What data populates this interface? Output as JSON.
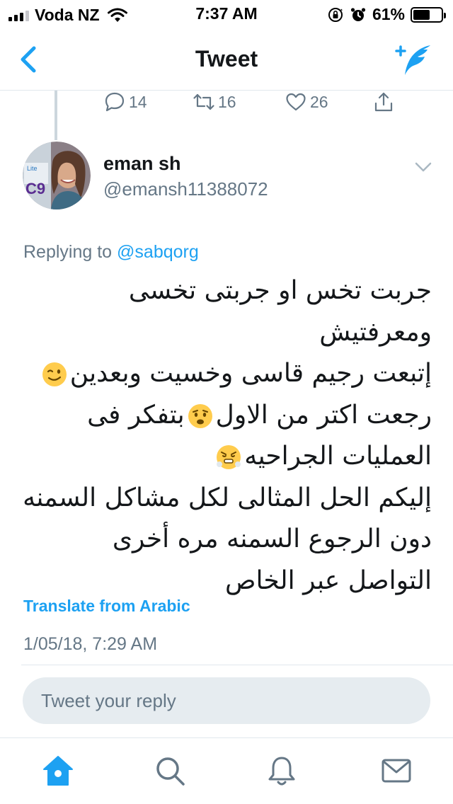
{
  "status_bar": {
    "carrier": "Voda NZ",
    "time": "7:37 AM",
    "battery_percent": "61%",
    "battery_level": 0.61,
    "signal_bars_filled": 3,
    "signal_bars_total": 4,
    "icons": [
      "signal-icon",
      "wifi-icon",
      "orientation-lock-icon",
      "alarm-icon",
      "battery-icon"
    ]
  },
  "nav": {
    "title": "Tweet",
    "back_icon": "chevron-left-icon",
    "compose_icon": "compose-tweet-icon"
  },
  "previous_tweet_actions": {
    "reply_count": "14",
    "retweet_count": "16",
    "like_count": "26"
  },
  "tweet": {
    "author_name": "eman sh",
    "author_handle": "@emansh11388072",
    "replying_prefix": "Replying to ",
    "replying_to": "@sabqorg",
    "text_lines": [
      "جربت تخس او جربتى تخسى ومعرفتيش",
      "إتبعت رجيم قاسى وخسيت وبعدين",
      "رجعت اكتر من الاول",
      "بتفكر فى",
      "العمليات الجراحيه",
      "إليكم الحل المثالى لكل مشاكل السمنه",
      "دون الرجوع السمنه مره أخرى",
      "التواصل عبر الخاص"
    ],
    "emojis": [
      "winking-face-emoji",
      "worried-face-emoji",
      "steaming-face-emoji"
    ],
    "translate_label": "Translate from Arabic",
    "timestamp": "1/05/18, 7:29 AM"
  },
  "reply_box": {
    "placeholder": "Tweet your reply"
  },
  "tab_bar": {
    "items": [
      "home-icon",
      "search-icon",
      "notifications-icon",
      "messages-icon"
    ],
    "active": "home-icon"
  },
  "colors": {
    "accent": "#1da1f2",
    "text_primary": "#14171a",
    "text_secondary": "#657786",
    "divider": "#e1e8ed",
    "reply_box_bg": "#e6ecf0"
  }
}
